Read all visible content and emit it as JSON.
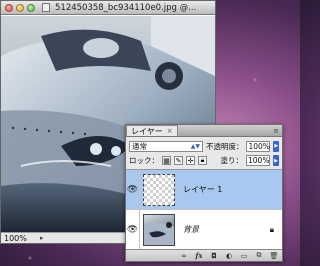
{
  "document_window": {
    "title": "512450358_bc934110e0.jpg @...",
    "zoom": "100%",
    "status_arrow": "▸"
  },
  "layers_panel": {
    "tab_label": "レイヤー",
    "tab_close": "×",
    "menu_icon": "≡",
    "blend_mode": "通常",
    "opacity_label": "不透明度：",
    "opacity_value": "100%",
    "lock_label": "ロック：",
    "fill_label": "塗り：",
    "fill_value": "100%",
    "layers": [
      {
        "name": "レイヤー 1",
        "selected": true,
        "visible": true
      },
      {
        "name": "背景",
        "selected": false,
        "visible": true,
        "locked": true
      }
    ],
    "footer_buttons": [
      "link-icon",
      "fx-icon",
      "mask-icon",
      "adjustment-icon",
      "group-folder-icon",
      "new-layer-icon",
      "trash-icon"
    ],
    "footer_fx_label": "fx"
  },
  "colors": {
    "selection_blue": "#a9c8f0",
    "accent_blue": "#3a64c8",
    "desktop_purple": "#8b4f8a"
  }
}
